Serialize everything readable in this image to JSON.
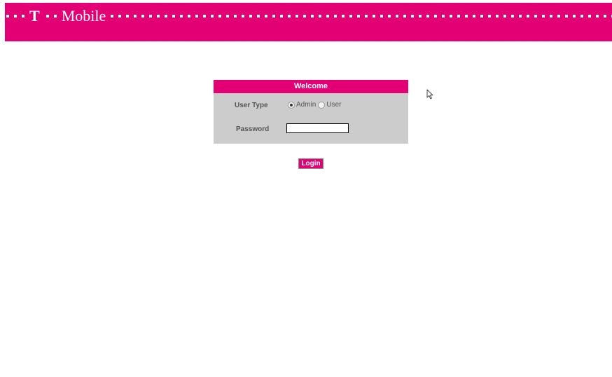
{
  "brand": {
    "logo_letter": "T",
    "logo_word": "Mobile",
    "color": "#e20074"
  },
  "login": {
    "title": "Welcome",
    "user_type_label": "User Type",
    "user_type_options": [
      "Admin",
      "User"
    ],
    "user_type_selected": "Admin",
    "password_label": "Password",
    "password_value": "",
    "login_label": "Login"
  },
  "icons": {
    "cursor": "mouse-pointer-icon"
  }
}
